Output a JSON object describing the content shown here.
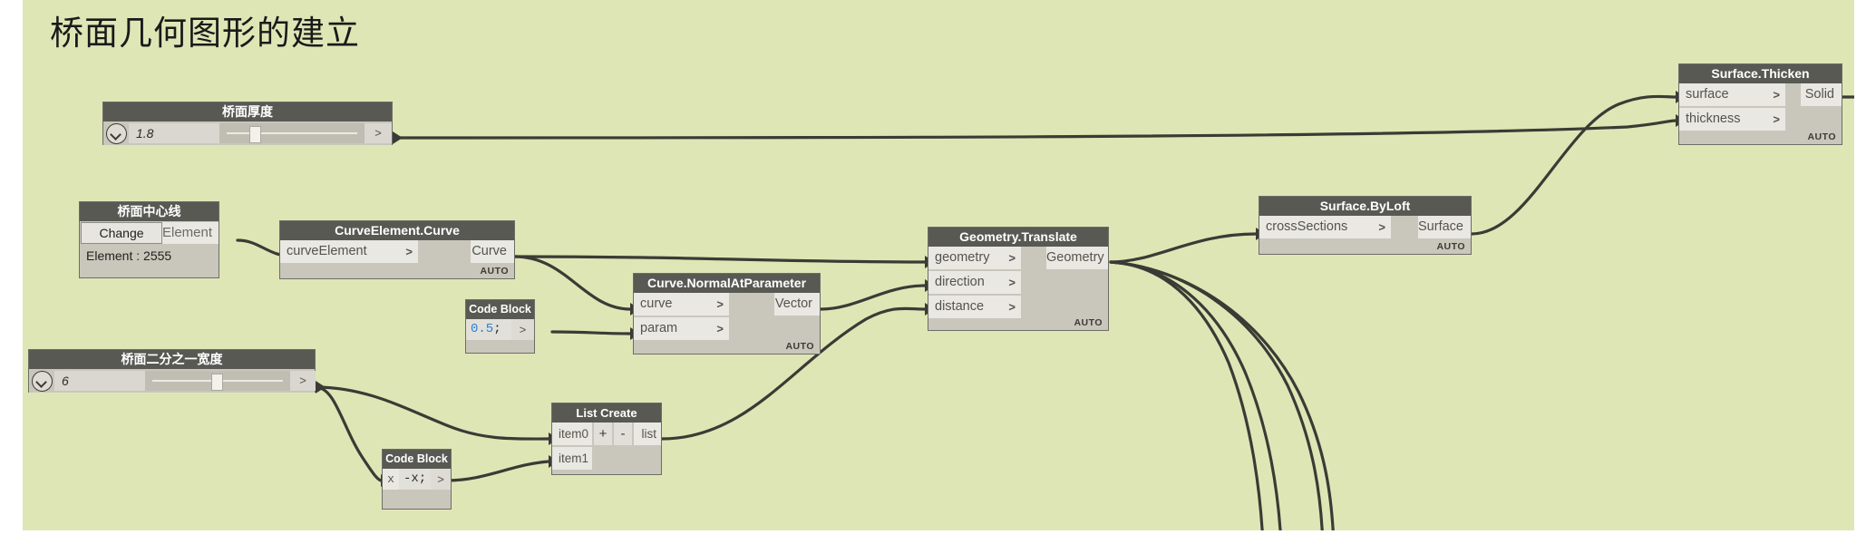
{
  "canvas": {
    "title": "桥面几何图形的建立",
    "background": "#dfe6b6",
    "node_header_color": "#595954",
    "node_body_color": "#c9c6bc",
    "port_color": "#e9e8e3",
    "wire_color": "#3b3b35",
    "auto_label": "AUTO"
  },
  "nodes": {
    "thickness_slider": {
      "title": "桥面厚度",
      "value": "1.8",
      "expand_icon": "chevron-down-icon",
      "output_chevron": ">"
    },
    "centerline_picker": {
      "title": "桥面中心线",
      "button": "Change",
      "output": "Element",
      "value": "Element : 2555"
    },
    "curve_element_curve": {
      "title": "CurveElement.Curve",
      "inputs": [
        "curveElement"
      ],
      "outputs": [
        "Curve"
      ],
      "auto": "AUTO",
      "chevron": ">"
    },
    "code_block_param": {
      "title": "Code Block",
      "code_number": "0.5",
      "code_tail": ";",
      "output_chevron": ">"
    },
    "curve_normal_at_parameter": {
      "title": "Curve.NormalAtParameter",
      "inputs": [
        "curve",
        "param"
      ],
      "outputs": [
        "Vector"
      ],
      "auto": "AUTO",
      "chevron": ">"
    },
    "geometry_translate": {
      "title": "Geometry.Translate",
      "inputs": [
        "geometry",
        "direction",
        "distance"
      ],
      "outputs": [
        "Geometry"
      ],
      "auto": "AUTO",
      "chevron": ">"
    },
    "surface_byloft": {
      "title": "Surface.ByLoft",
      "inputs": [
        "crossSections"
      ],
      "outputs": [
        "Surface"
      ],
      "auto": "AUTO",
      "chevron": ">"
    },
    "surface_thicken": {
      "title": "Surface.Thicken",
      "inputs": [
        "surface",
        "thickness"
      ],
      "outputs": [
        "Solid"
      ],
      "auto": "AUTO",
      "chevron": ">"
    },
    "halfwidth_slider": {
      "title": "桥面二分之一宽度",
      "value": "6",
      "expand_icon": "chevron-down-icon",
      "output_chevron": ">"
    },
    "code_block_negate": {
      "title": "Code Block",
      "input_port": "x",
      "code": "-x;",
      "output_chevron": ">"
    },
    "list_create": {
      "title": "List Create",
      "inputs": [
        "item0",
        "item1"
      ],
      "add_button": "+",
      "remove_button": "-",
      "outputs": [
        "list"
      ]
    }
  }
}
